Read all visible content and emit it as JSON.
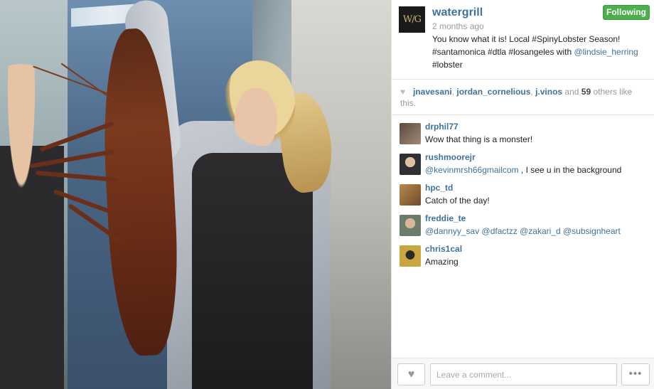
{
  "post": {
    "author": "watergrill",
    "logo_text": "W/G",
    "time_ago": "2 months ago",
    "follow_label": "Following",
    "follow_color": "#4cae4c",
    "caption_text": "You know what it is! Local #SpinyLobster Season! #santamonica #dtla #losangeles with ",
    "caption_mention": "@lindsie_herring",
    "caption_tail": " #lobster"
  },
  "likes": {
    "icon": "heart-icon",
    "likers": [
      "jnavesani",
      "jordan_cornelious",
      "j.vinos"
    ],
    "separator": ", ",
    "and_text": " and ",
    "others_count": "59",
    "others_text": " others like this."
  },
  "comments": [
    {
      "user": "drphil77",
      "text": "Wow that thing is a monster!",
      "mentions": "",
      "avatar_color": "#5a4a3e"
    },
    {
      "user": "rushmoorejr",
      "mentions": "@kevinmrsh66gmailcom",
      "text": " , I see u in the background",
      "avatar_color": "#2f3033"
    },
    {
      "user": "hpc_td",
      "text": "Catch of the day!",
      "mentions": "",
      "avatar_color": "#b88a4e"
    },
    {
      "user": "freddie_te",
      "mentions": "@dannyy_sav @dfactzz @zakari_d @subsignheart",
      "text": "",
      "avatar_color": "#6b7d6a"
    },
    {
      "user": "chris1cal",
      "text": "Amazing",
      "mentions": "",
      "avatar_color": "#c9a640"
    }
  ],
  "footer": {
    "comment_placeholder": "Leave a comment...",
    "like_icon": "heart-icon",
    "more_label": "•••"
  },
  "colors": {
    "link": "#3f729b",
    "muted": "#999999"
  }
}
